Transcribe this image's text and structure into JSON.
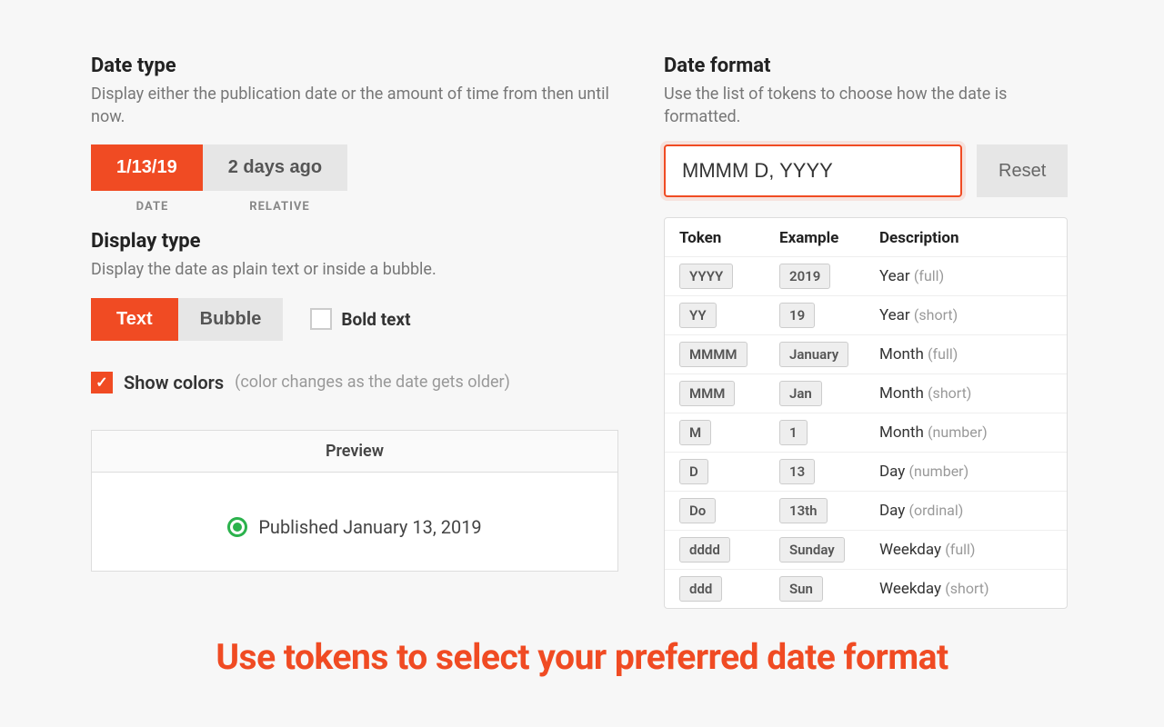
{
  "dateType": {
    "title": "Date type",
    "desc": "Display either the publication date or the amount of time from then until now.",
    "option1": "1/13/19",
    "option2": "2 days ago",
    "label1": "DATE",
    "label2": "RELATIVE"
  },
  "displayType": {
    "title": "Display type",
    "desc": "Display the date as plain text or inside a bubble.",
    "option1": "Text",
    "option2": "Bubble",
    "boldLabel": "Bold text"
  },
  "showColors": {
    "label": "Show colors",
    "hint": "(color changes as the date gets older)"
  },
  "preview": {
    "title": "Preview",
    "text": "Published January 13, 2019"
  },
  "dateFormat": {
    "title": "Date format",
    "desc": "Use the list of tokens to choose how the date is formatted.",
    "value": "MMMM D, YYYY",
    "reset": "Reset"
  },
  "tableHead": {
    "token": "Token",
    "example": "Example",
    "desc": "Description"
  },
  "tokens": [
    {
      "token": "YYYY",
      "example": "2019",
      "desc": "Year",
      "sub": "(full)"
    },
    {
      "token": "YY",
      "example": "19",
      "desc": "Year",
      "sub": "(short)"
    },
    {
      "token": "MMMM",
      "example": "January",
      "desc": "Month",
      "sub": "(full)"
    },
    {
      "token": "MMM",
      "example": "Jan",
      "desc": "Month",
      "sub": "(short)"
    },
    {
      "token": "M",
      "example": "1",
      "desc": "Month",
      "sub": "(number)"
    },
    {
      "token": "D",
      "example": "13",
      "desc": "Day",
      "sub": "(number)"
    },
    {
      "token": "Do",
      "example": "13th",
      "desc": "Day",
      "sub": "(ordinal)"
    },
    {
      "token": "dddd",
      "example": "Sunday",
      "desc": "Weekday",
      "sub": "(full)"
    },
    {
      "token": "ddd",
      "example": "Sun",
      "desc": "Weekday",
      "sub": "(short)"
    }
  ],
  "banner": "Use tokens to select your preferred date format"
}
